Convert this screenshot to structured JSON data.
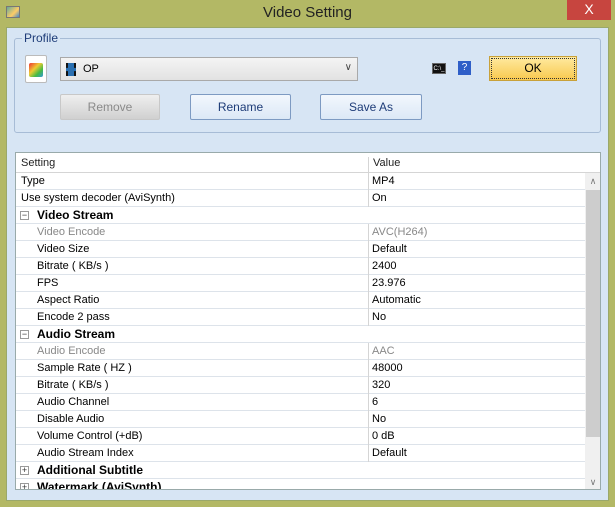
{
  "window": {
    "title": "Video Setting",
    "close": "X"
  },
  "profile": {
    "label": "Profile",
    "selected": "OP",
    "cmd_icon": "C:\\_",
    "help": "?",
    "ok": "OK",
    "remove": "Remove",
    "rename": "Rename",
    "save_as": "Save As"
  },
  "grid": {
    "headers": {
      "setting": "Setting",
      "value": "Value"
    },
    "rows": [
      {
        "k": "Type",
        "v": "MP4",
        "t": "row"
      },
      {
        "k": "Use system decoder (AviSynth)",
        "v": "On",
        "t": "row"
      },
      {
        "k": "Video Stream",
        "t": "cat",
        "tog": "−"
      },
      {
        "k": "Video Encode",
        "v": "AVC(H264)",
        "t": "sub ro"
      },
      {
        "k": "Video Size",
        "v": "Default",
        "t": "sub"
      },
      {
        "k": "Bitrate ( KB/s )",
        "v": "2400",
        "t": "sub"
      },
      {
        "k": "FPS",
        "v": "23.976",
        "t": "sub"
      },
      {
        "k": "Aspect Ratio",
        "v": "Automatic",
        "t": "sub"
      },
      {
        "k": "Encode 2 pass",
        "v": "No",
        "t": "sub"
      },
      {
        "k": "Audio Stream",
        "t": "cat",
        "tog": "−"
      },
      {
        "k": "Audio Encode",
        "v": "AAC",
        "t": "sub ro"
      },
      {
        "k": "Sample Rate ( HZ )",
        "v": "48000",
        "t": "sub"
      },
      {
        "k": "Bitrate ( KB/s )",
        "v": "320",
        "t": "sub"
      },
      {
        "k": "Audio Channel",
        "v": "6",
        "t": "sub"
      },
      {
        "k": "Disable Audio",
        "v": "No",
        "t": "sub"
      },
      {
        "k": "Volume Control (+dB)",
        "v": "0 dB",
        "t": "sub"
      },
      {
        "k": "Audio Stream Index",
        "v": "Default",
        "t": "sub"
      },
      {
        "k": "Additional Subtitle",
        "t": "cat",
        "tog": "+"
      },
      {
        "k": "Watermark (AviSynth)",
        "t": "cat",
        "tog": "+"
      }
    ]
  }
}
